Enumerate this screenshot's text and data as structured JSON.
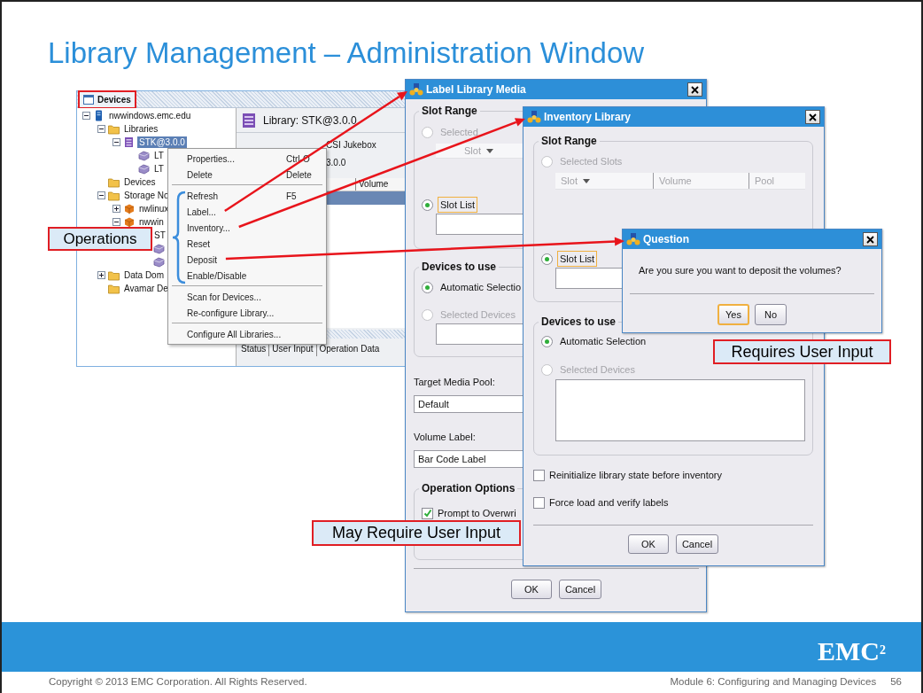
{
  "slide_title": "Library Management – Administration Window",
  "devices_window": {
    "title": "Devices",
    "tree": [
      {
        "label": "nwwindows.emc.edu",
        "kind": "server",
        "expanded": true,
        "selected": false,
        "children": [
          {
            "label": "Libraries",
            "kind": "folder",
            "expanded": true,
            "selected": false,
            "children": [
              {
                "label": "STK@3.0.0",
                "kind": "library",
                "expanded": true,
                "selected": true,
                "children": [
                  {
                    "label": "LT",
                    "kind": "drive",
                    "selected": false
                  },
                  {
                    "label": "LT",
                    "kind": "drive",
                    "selected": false
                  }
                ]
              }
            ]
          },
          {
            "label": "Devices",
            "kind": "folder",
            "selected": false
          },
          {
            "label": "Storage No",
            "kind": "folder",
            "expanded": true,
            "selected": false,
            "children": [
              {
                "label": "nwlinux",
                "kind": "node",
                "expanded": false,
                "selected": false
              },
              {
                "label": "nwwin",
                "kind": "node",
                "expanded": true,
                "selected": false,
                "children": [
                  {
                    "label": "ST",
                    "kind": "library",
                    "selected": false,
                    "children": [
                      {
                        "kind": "drive",
                        "selected": false
                      },
                      {
                        "kind": "drive",
                        "selected": false
                      }
                    ]
                  }
                ]
              }
            ]
          },
          {
            "label": "Data Dom",
            "kind": "folder",
            "expanded": false,
            "selected": false
          },
          {
            "label": "Avamar De",
            "kind": "folder",
            "selected": false
          }
        ]
      }
    ],
    "detail": {
      "heading": "Library: STK@3.0.0",
      "type": "CSI Jukebox",
      "address": "3.0.0",
      "columns": [
        "Volume"
      ],
      "rows": [
        {
          "selected": true
        }
      ],
      "status_columns": [
        "Status",
        "User Input",
        "Operation Data"
      ]
    }
  },
  "context_menu": [
    {
      "kind": "item",
      "label": "Properties...",
      "shortcut": "Ctrl-O"
    },
    {
      "kind": "item",
      "label": "Delete",
      "shortcut": "Delete"
    },
    {
      "kind": "separator"
    },
    {
      "kind": "item",
      "label": "Refresh",
      "shortcut": "F5"
    },
    {
      "kind": "item",
      "label": "Label..."
    },
    {
      "kind": "item",
      "label": "Inventory..."
    },
    {
      "kind": "item",
      "label": "Reset"
    },
    {
      "kind": "item",
      "label": "Deposit"
    },
    {
      "kind": "item",
      "label": "Enable/Disable"
    },
    {
      "kind": "separator"
    },
    {
      "kind": "item",
      "label": "Scan for Devices..."
    },
    {
      "kind": "item",
      "label": "Re-configure Library..."
    },
    {
      "kind": "separator"
    },
    {
      "kind": "item",
      "label": "Configure All Libraries..."
    }
  ],
  "callouts": [
    {
      "text": "Operations"
    },
    {
      "text": "May Require User Input"
    },
    {
      "text": "Requires User Input"
    }
  ],
  "label_dialog": {
    "title": "Label Library Media",
    "slot_range": {
      "legend": "Slot Range",
      "columns": [
        "Slot"
      ],
      "options": [
        {
          "label": "Selected",
          "selected": false,
          "disabled": true,
          "focused": false
        },
        {
          "label": "Slot List",
          "selected": true,
          "disabled": false,
          "focused": true
        }
      ]
    },
    "devices": {
      "legend": "Devices to use",
      "options": [
        {
          "label": "Automatic Selectio",
          "selected": true,
          "disabled": false,
          "focused": false
        },
        {
          "label": "Selected Devices",
          "selected": false,
          "disabled": true,
          "focused": false
        }
      ]
    },
    "target_pool": {
      "label": "Target Media Pool:",
      "value": "Default"
    },
    "volume_label": {
      "label": "Volume Label:",
      "value": "Bar Code Label"
    },
    "operation_options": {
      "legend": "Operation Options",
      "options": [
        {
          "label": "Prompt to Overwri",
          "checked": true
        }
      ]
    },
    "buttons": [
      "OK",
      "Cancel"
    ]
  },
  "inventory_dialog": {
    "title": "Inventory Library",
    "slot_range": {
      "legend": "Slot Range",
      "columns": [
        "Slot",
        "Volume",
        "Pool"
      ],
      "options": [
        {
          "label": "Selected Slots",
          "selected": false,
          "disabled": true,
          "focused": false
        },
        {
          "label": "Slot List",
          "selected": true,
          "disabled": false,
          "focused": true
        }
      ]
    },
    "devices": {
      "legend": "Devices to use",
      "options": [
        {
          "label": "Automatic Selection",
          "selected": true,
          "disabled": false,
          "focused": false
        },
        {
          "label": "Selected Devices",
          "selected": false,
          "disabled": true,
          "focused": false
        }
      ]
    },
    "checkboxes": [
      {
        "label": "Reinitialize library state before inventory",
        "checked": false
      },
      {
        "label": "Force load and verify labels",
        "checked": false
      }
    ],
    "buttons": [
      "OK",
      "Cancel"
    ]
  },
  "question_dialog": {
    "title": "Question",
    "message": "Are you sure you want to deposit the volumes?",
    "buttons": [
      {
        "label": "Yes",
        "focused": true
      },
      {
        "label": "No",
        "focused": false
      }
    ]
  },
  "footer": {
    "logo": "EMC$^{2}$",
    "copyright": "Copyright © 2013 EMC Corporation. All Rights Reserved.",
    "module": "Module 6: Configuring and Managing Devices",
    "page": "56"
  }
}
